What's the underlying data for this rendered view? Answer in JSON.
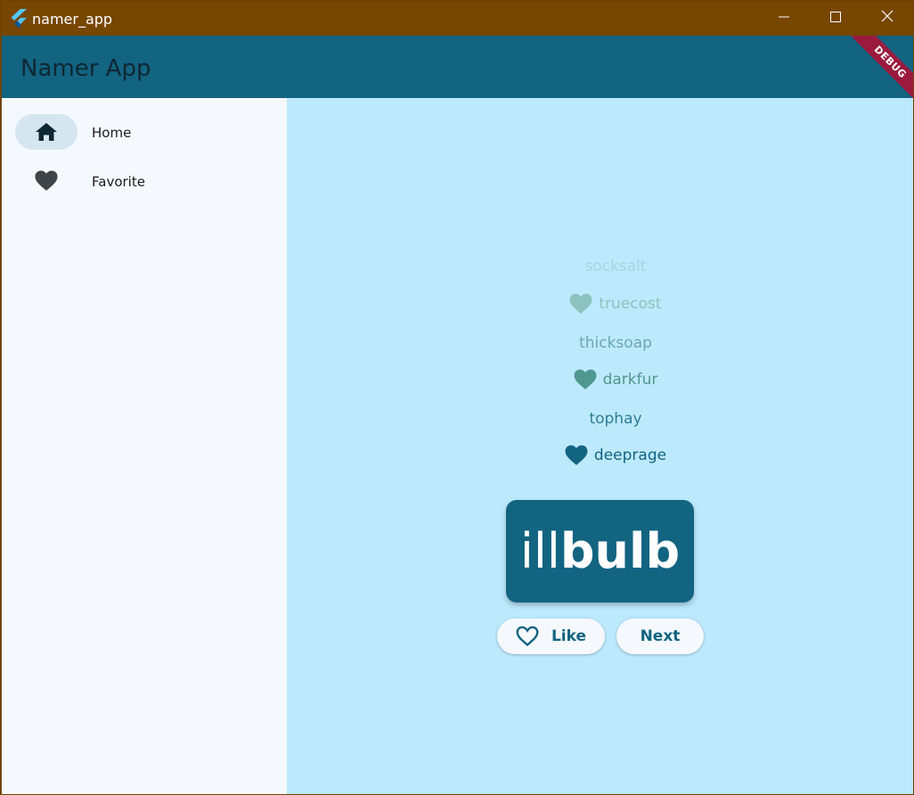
{
  "window": {
    "title": "namer_app",
    "colors": {
      "titlebar": "#774601"
    }
  },
  "appbar": {
    "title": "Namer App",
    "debug_label": "DEBUG",
    "colors": {
      "background": "#126481",
      "debug": "#9b1b3e"
    }
  },
  "nav": {
    "items": [
      {
        "label": "Home",
        "icon": "home-icon",
        "selected": true
      },
      {
        "label": "Favorite",
        "icon": "heart-icon",
        "selected": false
      }
    ]
  },
  "history": [
    {
      "text": "socksalt",
      "liked": false,
      "color": "#a9d3e0"
    },
    {
      "text": "truecost",
      "liked": true,
      "color": "#8cc3bf"
    },
    {
      "text": "thicksoap",
      "liked": false,
      "color": "#6aa7b4"
    },
    {
      "text": "darkfur",
      "liked": true,
      "color": "#4f978f"
    },
    {
      "text": "tophay",
      "liked": false,
      "color": "#2e7e93"
    },
    {
      "text": "deeprage",
      "liked": true,
      "color": "#126481"
    }
  ],
  "current_pair": {
    "first": "ill",
    "second": "bulb"
  },
  "buttons": {
    "like_label": "Like",
    "next_label": "Next"
  }
}
